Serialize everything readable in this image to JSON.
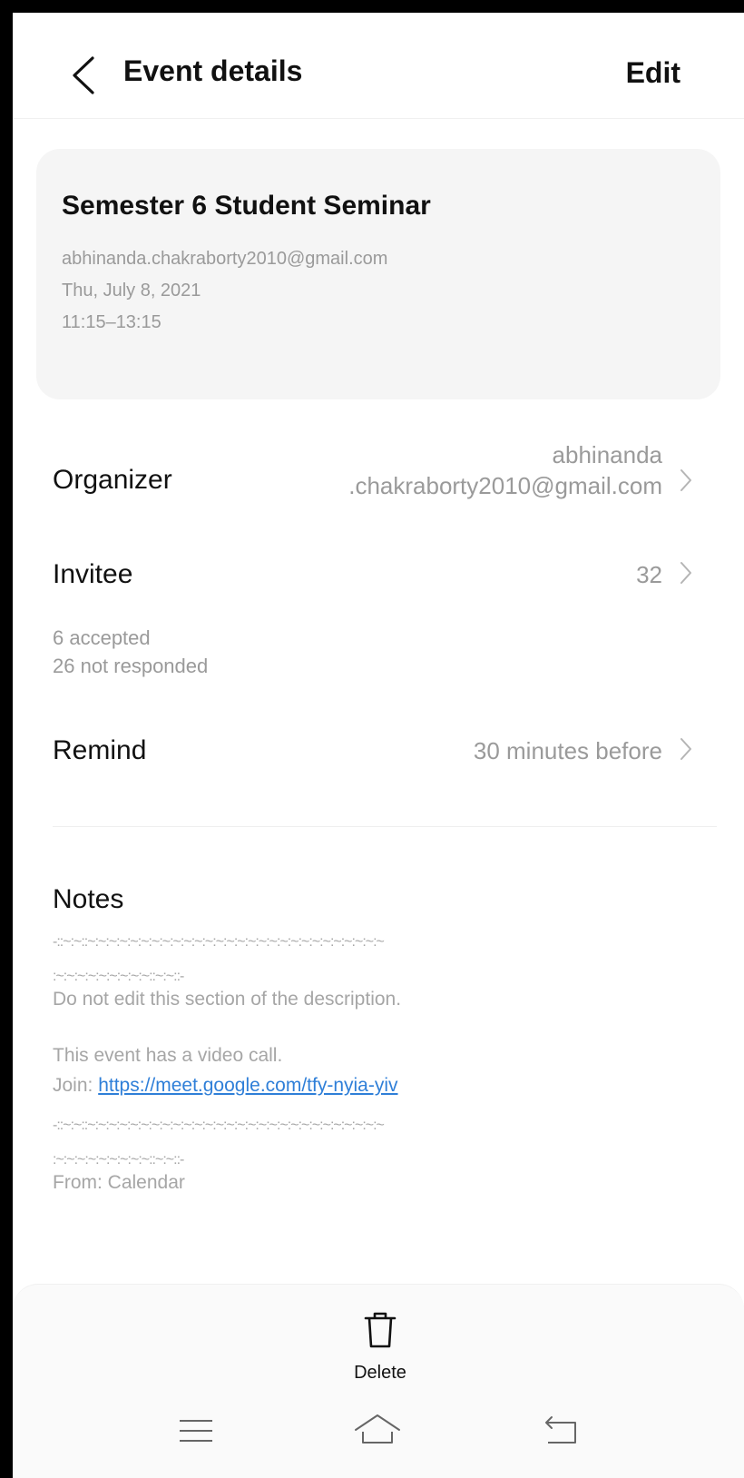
{
  "header": {
    "title": "Event details",
    "edit_label": "Edit"
  },
  "event": {
    "title": "Semester 6 Student Seminar",
    "calendar_account": "abhinanda.chakraborty2010@gmail.com",
    "date": "Thu, July 8, 2021",
    "time": "11:15–13:15"
  },
  "organizer": {
    "label": "Organizer",
    "value_line1": "abhinanda",
    "value_line2": ".chakraborty2010@gmail.com"
  },
  "invitee": {
    "label": "Invitee",
    "count": "32",
    "accepted": "6 accepted",
    "not_responded": "26 not responded"
  },
  "remind": {
    "label": "Remind",
    "value": "30 minutes before"
  },
  "notes": {
    "title": "Notes",
    "separator_top": "-::~:~::~:~:~:~:~:~:~:~:~:~:~:~:~:~:~:~:~:~:~:~:~:~:~:~:~:~:~:~",
    "separator_bottom": ":~:~:~:~:~:~:~:~:~::~:~::-",
    "warning": "Do not edit this section of the description.",
    "video_call": "This event has a video call.",
    "join_prefix": "Join: ",
    "join_link": "https://meet.google.com/tfy-nyia-yiv",
    "from": "From: Calendar"
  },
  "actions": {
    "delete_label": "Delete"
  },
  "icons": {
    "back": "chevron-left-icon",
    "chevron": "chevron-right-icon",
    "delete": "trash-icon",
    "nav_menu": "menu-icon",
    "nav_home": "home-icon",
    "nav_back": "back-icon"
  }
}
